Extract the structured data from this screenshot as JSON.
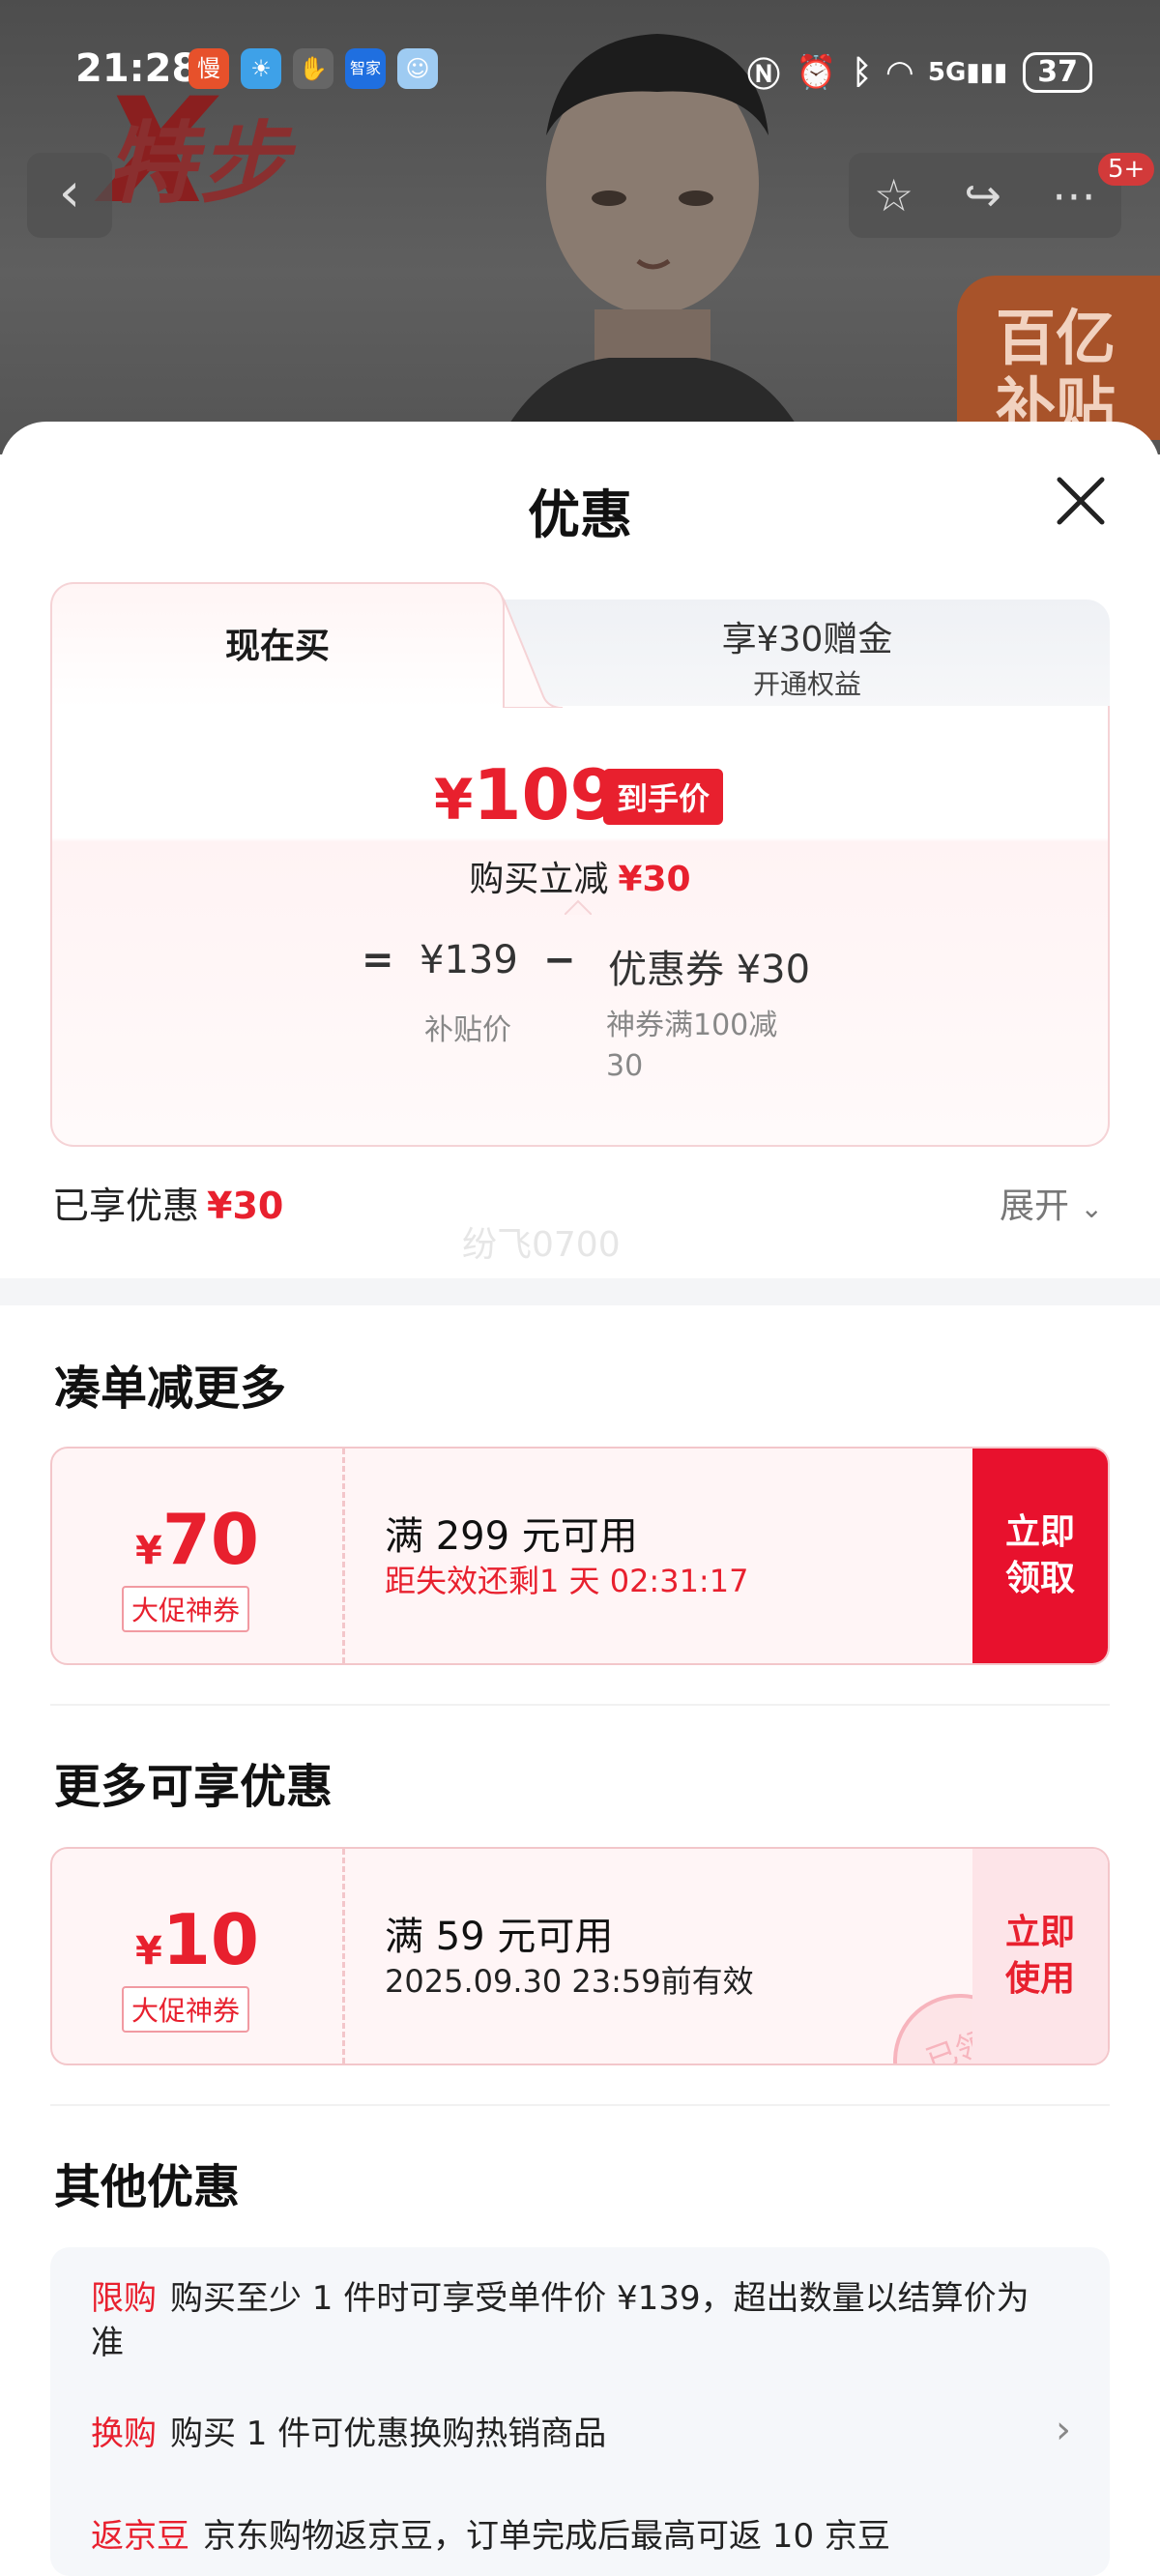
{
  "status_bar": {
    "time": "21:28",
    "battery": "37"
  },
  "product_header": {
    "brand": "特步",
    "promo_badge": "百亿\n补贴",
    "badge_count": "5+"
  },
  "sheet": {
    "title": "优惠",
    "tabs": {
      "active": "现在买",
      "other_line1": "享¥30赠金",
      "other_line2": "开通权益"
    },
    "price": {
      "yen": "¥",
      "amount": "109",
      "tag": "到手价",
      "reduce_text": "购买立减",
      "reduce_amount": "¥30",
      "eq": "=",
      "base": "¥139",
      "minus": "−",
      "coupon": "优惠券 ¥30",
      "base_label": "补贴价",
      "coupon_label": "神券满100减30"
    },
    "enjoyed_label": "已享优惠",
    "enjoyed_amount": "¥30",
    "expand_label": "展开",
    "watermark": "纷飞0700"
  },
  "sections": {
    "more_title": "凑单减更多",
    "extra_title": "更多可享优惠",
    "other_title": "其他优惠"
  },
  "coupon1": {
    "yen": "¥",
    "amount": "70",
    "label": "大促神券",
    "condition": "满 299 元可用",
    "sub": "距失效还剩1 天 02:31:17",
    "cta": "立即\n领取"
  },
  "coupon2": {
    "yen": "¥",
    "amount": "10",
    "label": "大促神券",
    "condition": "满 59 元可用",
    "sub": "2025.09.30 23:59前有效",
    "cta": "立即\n使用",
    "stamp": "已领"
  },
  "other_offers": [
    {
      "tag": "限购",
      "text": "购买至少 1 件时可享受单件价 ¥139，超出数量以结算价为准"
    },
    {
      "tag": "换购",
      "text": "购买 1 件可优惠换购热销商品"
    },
    {
      "tag": "返京豆",
      "text": "京东购物返京豆，订单完成后最高可返 10 京豆"
    }
  ],
  "colors": {
    "accent_red": "#e8202e",
    "coupon_bg": "#fff5f6"
  }
}
